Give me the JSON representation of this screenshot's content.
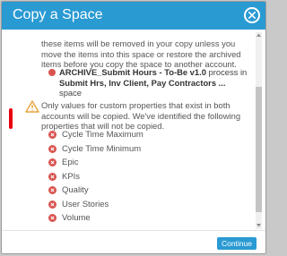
{
  "dialog": {
    "title": "Copy a Space",
    "intro_text": "these items will be removed in your copy unless you move the items into this space or restore the archived items before you copy the space to another account.",
    "archive_item": {
      "name": "ARCHIVE_Submit Hours - To-Be v1.0",
      "middle": " process in ",
      "space": "Submit Hrs, Inv Client, Pay Contractors ...",
      "suffix": " space"
    },
    "warning_text": "Only values for custom properties that exist in both accounts will be copied. We've identified the following properties that will not be copied.",
    "properties": [
      "Cycle Time Maximum",
      "Cycle Time Minimum",
      "Epic",
      "KPIs",
      "Quality",
      "User Stories",
      "Volume"
    ],
    "continue_label": "Continue"
  },
  "colors": {
    "accent": "#2a9ad3",
    "error": "#d9534f",
    "warning": "#e8a33d",
    "marker": "#e8000f"
  },
  "icons": {
    "close": "close-circle-icon",
    "warning": "warning-triangle-icon",
    "remove": "x-circle-icon"
  }
}
